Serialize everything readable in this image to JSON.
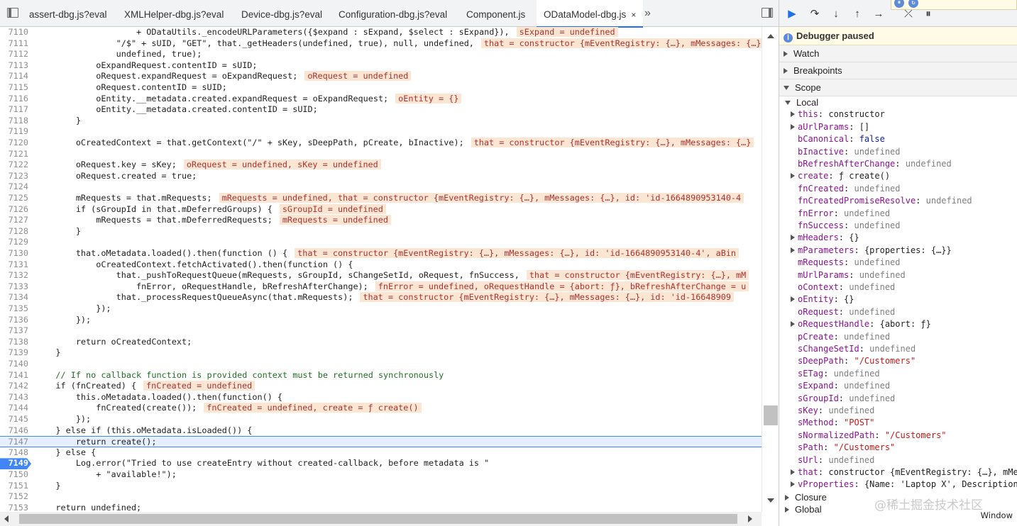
{
  "tabs": [
    {
      "label": "assert-dbg.js?eval",
      "active": false
    },
    {
      "label": "XMLHelper-dbg.js?eval",
      "active": false
    },
    {
      "label": "Device-dbg.js?eval",
      "active": false
    },
    {
      "label": "Configuration-dbg.js?eval",
      "active": false
    },
    {
      "label": "Component.js",
      "active": false
    },
    {
      "label": "ODataModel-dbg.js",
      "active": true
    }
  ],
  "tab_close": "×",
  "more_tabs": "»",
  "code_lines": [
    {
      "n": "7110",
      "code": "                    + ODataUtils._encodeURLParameters({$expand : sExpand, $select : sExpand}),",
      "inline": "sExpand = undefined"
    },
    {
      "n": "7111",
      "code": "                \"/$\" + sUID, \"GET\", that._getHeaders(undefined, true), null, undefined,",
      "inline": "that = constructor {mEventRegistry: {…}, mMessages: {…}"
    },
    {
      "n": "7112",
      "code": "                undefined, true);",
      "inline": ""
    },
    {
      "n": "7113",
      "code": "            oExpandRequest.contentID = sUID;",
      "inline": ""
    },
    {
      "n": "7114",
      "code": "            oRequest.expandRequest = oExpandRequest;",
      "inline": "oRequest = undefined"
    },
    {
      "n": "7115",
      "code": "            oRequest.contentID = sUID;",
      "inline": ""
    },
    {
      "n": "7116",
      "code": "            oEntity.__metadata.created.expandRequest = oExpandRequest;",
      "inline": "oEntity = {}"
    },
    {
      "n": "7117",
      "code": "            oEntity.__metadata.created.contentID = sUID;",
      "inline": ""
    },
    {
      "n": "7118",
      "code": "        }",
      "inline": ""
    },
    {
      "n": "7119",
      "code": "",
      "inline": ""
    },
    {
      "n": "7120",
      "code": "        oCreatedContext = that.getContext(\"/\" + sKey, sDeepPath, pCreate, bInactive);",
      "inline": "that = constructor {mEventRegistry: {…}, mMessages: {…}"
    },
    {
      "n": "7121",
      "code": "",
      "inline": ""
    },
    {
      "n": "7122",
      "code": "        oRequest.key = sKey;",
      "inline": "oRequest = undefined, sKey = undefined"
    },
    {
      "n": "7123",
      "code": "        oRequest.created = true;",
      "inline": ""
    },
    {
      "n": "7124",
      "code": "",
      "inline": ""
    },
    {
      "n": "7125",
      "code": "        mRequests = that.mRequests;",
      "inline": "mRequests = undefined, that = constructor {mEventRegistry: {…}, mMessages: {…}, id: 'id-1664890953140-4"
    },
    {
      "n": "7126",
      "code": "        if (sGroupId in that.mDeferredGroups) {",
      "inline": "sGroupId = undefined"
    },
    {
      "n": "7127",
      "code": "            mRequests = that.mDeferredRequests;",
      "inline": "mRequests = undefined"
    },
    {
      "n": "7128",
      "code": "        }",
      "inline": ""
    },
    {
      "n": "7129",
      "code": "",
      "inline": ""
    },
    {
      "n": "7130",
      "code": "        that.oMetadata.loaded().then(function () {",
      "inline": "that = constructor {mEventRegistry: {…}, mMessages: {…}, id: 'id-1664890953140-4', aBin"
    },
    {
      "n": "7131",
      "code": "            oCreatedContext.fetchActivated().then(function () {",
      "inline": ""
    },
    {
      "n": "7132",
      "code": "                that._pushToRequestQueue(mRequests, sGroupId, sChangeSetId, oRequest, fnSuccess,",
      "inline": "that = constructor {mEventRegistry: {…}, mM"
    },
    {
      "n": "7133",
      "code": "                    fnError, oRequestHandle, bRefreshAfterChange);",
      "inline": "fnError = undefined, oRequestHandle = {abort: ƒ}, bRefreshAfterChange = u"
    },
    {
      "n": "7134",
      "code": "                that._processRequestQueueAsync(that.mRequests);",
      "inline": "that = constructor {mEventRegistry: {…}, mMessages: {…}, id: 'id-16648909"
    },
    {
      "n": "7135",
      "code": "            });",
      "inline": ""
    },
    {
      "n": "7136",
      "code": "        });",
      "inline": ""
    },
    {
      "n": "7137",
      "code": "",
      "inline": ""
    },
    {
      "n": "7138",
      "code": "        return oCreatedContext;",
      "inline": ""
    },
    {
      "n": "7139",
      "code": "    }",
      "inline": ""
    },
    {
      "n": "7140",
      "code": "",
      "inline": ""
    },
    {
      "n": "7141",
      "code": "    // If no callback function is provided context must be returned synchronously",
      "inline": ""
    },
    {
      "n": "7142",
      "code": "    if (fnCreated) {",
      "inline": "fnCreated = undefined"
    },
    {
      "n": "7143",
      "code": "        this.oMetadata.loaded().then(function() {",
      "inline": ""
    },
    {
      "n": "7144",
      "code": "            fnCreated(create());",
      "inline": "fnCreated = undefined, create = ƒ create()"
    },
    {
      "n": "7145",
      "code": "        });",
      "inline": ""
    },
    {
      "n": "7146",
      "code": "    } else if (this.oMetadata.isLoaded()) {",
      "inline": ""
    },
    {
      "n": "7147",
      "code": "        return create();",
      "inline": ""
    },
    {
      "n": "7148",
      "code": "    } else {",
      "inline": ""
    },
    {
      "n": "7149",
      "code": "        Log.error(\"Tried to use createEntry without created-callback, before metadata is \"",
      "inline": ""
    },
    {
      "n": "7150",
      "code": "            + \"available!\");",
      "inline": ""
    },
    {
      "n": "7151",
      "code": "    }",
      "inline": ""
    },
    {
      "n": "7152",
      "code": "",
      "inline": ""
    },
    {
      "n": "7153",
      "code": "    return undefined;",
      "inline": ""
    }
  ],
  "current_line": "7147",
  "breakpoint_line": "7149",
  "debugger": {
    "paused_label": "Debugger paused",
    "sections": {
      "watch": "Watch",
      "breakpoints": "Breakpoints",
      "scope": "Scope",
      "local": "Local",
      "closure": "Closure",
      "global": "Global",
      "global_value": "Window"
    },
    "scope": [
      {
        "expand": true,
        "name": "this",
        "value": "constructor",
        "type": "obj"
      },
      {
        "expand": true,
        "name": "aUrlParams",
        "value": "[]",
        "type": "obj"
      },
      {
        "expand": false,
        "name": "bCanonical",
        "value": "false",
        "type": "kw"
      },
      {
        "expand": false,
        "name": "bInactive",
        "value": "undefined",
        "type": "undef"
      },
      {
        "expand": false,
        "name": "bRefreshAfterChange",
        "value": "undefined",
        "type": "undef"
      },
      {
        "expand": true,
        "name": "create",
        "value": "ƒ create()",
        "type": "obj"
      },
      {
        "expand": false,
        "name": "fnCreated",
        "value": "undefined",
        "type": "undef"
      },
      {
        "expand": false,
        "name": "fnCreatedPromiseResolve",
        "value": "undefined",
        "type": "undef"
      },
      {
        "expand": false,
        "name": "fnError",
        "value": "undefined",
        "type": "undef"
      },
      {
        "expand": false,
        "name": "fnSuccess",
        "value": "undefined",
        "type": "undef"
      },
      {
        "expand": true,
        "name": "mHeaders",
        "value": "{}",
        "type": "obj"
      },
      {
        "expand": true,
        "name": "mParameters",
        "value": "{properties: {…}}",
        "type": "obj"
      },
      {
        "expand": false,
        "name": "mRequests",
        "value": "undefined",
        "type": "undef"
      },
      {
        "expand": false,
        "name": "mUrlParams",
        "value": "undefined",
        "type": "undef"
      },
      {
        "expand": false,
        "name": "oContext",
        "value": "undefined",
        "type": "undef"
      },
      {
        "expand": true,
        "name": "oEntity",
        "value": "{}",
        "type": "obj"
      },
      {
        "expand": false,
        "name": "oRequest",
        "value": "undefined",
        "type": "undef"
      },
      {
        "expand": true,
        "name": "oRequestHandle",
        "value": "{abort: ƒ}",
        "type": "obj"
      },
      {
        "expand": false,
        "name": "pCreate",
        "value": "undefined",
        "type": "undef"
      },
      {
        "expand": false,
        "name": "sChangeSetId",
        "value": "undefined",
        "type": "undef"
      },
      {
        "expand": false,
        "name": "sDeepPath",
        "value": "\"/Customers\"",
        "type": "str"
      },
      {
        "expand": false,
        "name": "sETag",
        "value": "undefined",
        "type": "undef"
      },
      {
        "expand": false,
        "name": "sExpand",
        "value": "undefined",
        "type": "undef"
      },
      {
        "expand": false,
        "name": "sGroupId",
        "value": "undefined",
        "type": "undef"
      },
      {
        "expand": false,
        "name": "sKey",
        "value": "undefined",
        "type": "undef"
      },
      {
        "expand": false,
        "name": "sMethod",
        "value": "\"POST\"",
        "type": "str"
      },
      {
        "expand": false,
        "name": "sNormalizedPath",
        "value": "\"/Customers\"",
        "type": "str"
      },
      {
        "expand": false,
        "name": "sPath",
        "value": "\"/Customers\"",
        "type": "str"
      },
      {
        "expand": false,
        "name": "sUrl",
        "value": "undefined",
        "type": "undef"
      },
      {
        "expand": true,
        "name": "that",
        "value": "constructor {mEventRegistry: {…}, mMe",
        "type": "obj"
      },
      {
        "expand": true,
        "name": "vProperties",
        "value": "{Name: 'Laptop X', Description",
        "type": "obj"
      }
    ]
  },
  "watermark": "@稀土掘金技术社区",
  "colors": {
    "accent": "#1a73e8",
    "inline_bg": "#fbe6d4",
    "breakpoint": "#4285f4"
  }
}
